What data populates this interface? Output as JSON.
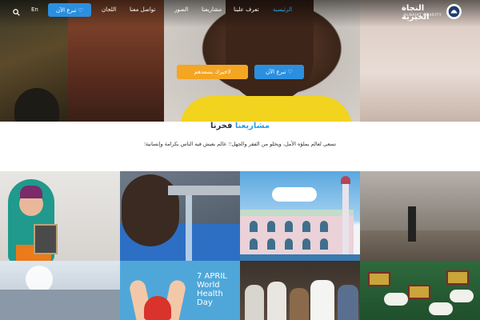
{
  "header": {
    "logo": {
      "name_ar": "النجاة الخيرية",
      "name_en": "ALNAJAT CHARITY"
    },
    "nav": [
      {
        "label": "الرئيسية",
        "active": true
      },
      {
        "label": "تعرف علينا",
        "active": false
      },
      {
        "label": "مشاريعنا",
        "active": false
      },
      {
        "label": "الصور",
        "active": false
      },
      {
        "label": "تواصل معنا",
        "active": false
      },
      {
        "label": "اللجان",
        "active": false
      }
    ],
    "donate_label": "تبرع الآن ♡",
    "language_label": "En",
    "search_icon": "search-icon"
  },
  "hero": {
    "donate_button_label": "تبرع الآن ♡",
    "good_button_label": "لاخيرك يسعدهم"
  },
  "section": {
    "title_blue": "مشاريعنا",
    "title_dark": " فخرنا",
    "subtitle": "نسعى لعالم يملؤه الأمل، ويخلو من الفقر والجهل؛؛ عالم يعيش فيه الناس بكرامة وإنسانية؛"
  },
  "gallery": {
    "tile6_text": {
      "line1": "7 APRIL",
      "line2": "World",
      "line3": "Health",
      "line4": "Day"
    }
  },
  "colors": {
    "accent_blue": "#2b8fe0",
    "accent_orange": "#f4a522",
    "title_dark": "#2c3340"
  }
}
